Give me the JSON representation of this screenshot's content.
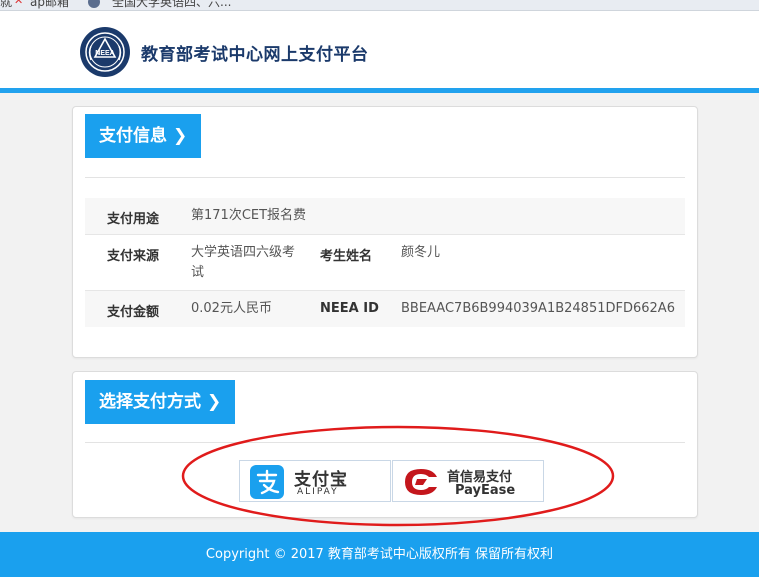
{
  "browser": {
    "bookmarks": [
      {
        "label": "ap邮箱",
        "icon": "bookmark-red-icon"
      },
      {
        "label": "全国大学英语四、六...",
        "icon": "bookmark-emblem-icon"
      }
    ]
  },
  "header": {
    "title": "教育部考试中心网上支付平台",
    "logo_text": "NEEA",
    "accent_color": "#22a2ee"
  },
  "payment_info": {
    "section_label": "支付信息",
    "rows": [
      {
        "label": "支付用途",
        "value": "第171次CET报名费"
      },
      {
        "label": "支付来源",
        "value": "大学英语四六级考试",
        "label2": "考生姓名",
        "value2": "颜冬儿"
      },
      {
        "label": "支付金额",
        "value": "0.02元人民币",
        "label2": "NEEA ID",
        "value2": "BBEAAC7B6B994039A1B24851DFD662A6"
      }
    ]
  },
  "payment_method": {
    "section_label": "选择支付方式",
    "options": [
      {
        "name": "支付宝",
        "sub": "ALIPAY",
        "icon": "alipay-icon",
        "color": "#1aa0ee"
      },
      {
        "name": "首信易支付",
        "sub": "PayEase",
        "icon": "payease-icon",
        "color": "#c4161c"
      }
    ]
  },
  "footer": {
    "copyright": "Copyright © 2017 教育部考试中心版权所有 保留所有权利"
  }
}
